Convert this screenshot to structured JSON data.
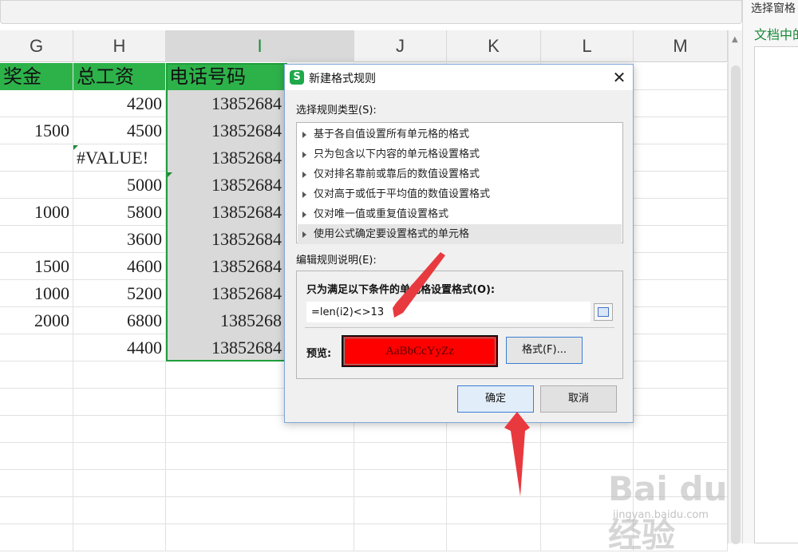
{
  "columns": [
    {
      "label": "G",
      "selected": false
    },
    {
      "label": "H",
      "selected": false
    },
    {
      "label": "I",
      "selected": true
    },
    {
      "label": "J",
      "selected": false
    },
    {
      "label": "K",
      "selected": false
    },
    {
      "label": "L",
      "selected": false
    },
    {
      "label": "M",
      "selected": false
    }
  ],
  "header_row": {
    "g": "奖金",
    "h": "总工资",
    "i": "电话号码"
  },
  "rows": [
    {
      "g": "",
      "h": "4200",
      "i": "13852684"
    },
    {
      "g": "1500",
      "h": "4500",
      "i": "13852684"
    },
    {
      "g": "",
      "h": "#VALUE!",
      "i": "13852684"
    },
    {
      "g": "",
      "h": "5000",
      "i": "13852684"
    },
    {
      "g": "1000",
      "h": "5800",
      "i": "13852684"
    },
    {
      "g": "",
      "h": "3600",
      "i": "13852684"
    },
    {
      "g": "1500",
      "h": "4600",
      "i": "13852684"
    },
    {
      "g": "1000",
      "h": "5200",
      "i": "13852684"
    },
    {
      "g": "2000",
      "h": "6800",
      "i": "1385268"
    },
    {
      "g": "",
      "h": "4400",
      "i": "13852684"
    }
  ],
  "pane": {
    "title": "选择窗格",
    "subtitle": "文档中的"
  },
  "dialog": {
    "logo": "S",
    "title": "新建格式规则",
    "close_glyph": "✕",
    "rule_type_label": "选择规则类型(S):",
    "rule_types": [
      "基于各自值设置所有单元格的格式",
      "只为包含以下内容的单元格设置格式",
      "仅对排名靠前或靠后的数值设置格式",
      "仅对高于或低于平均值的数值设置格式",
      "仅对唯一值或重复值设置格式",
      "使用公式确定要设置格式的单元格"
    ],
    "selected_rule_index": 5,
    "edit_desc_label": "编辑规则说明(E):",
    "condition_label": "只为满足以下条件的单元格设置格式(O):",
    "formula_value": "=len(i2)<>13",
    "picker_icon": "range-picker-icon",
    "preview_label": "预览:",
    "preview_text": "AaBbCcYyZz",
    "format_button": "格式(F)...",
    "ok_button": "确定",
    "cancel_button": "取消"
  },
  "watermark": {
    "main": "Bai du 经验",
    "sub": "jingyan.baidu.com"
  },
  "colors": {
    "header_green": "#2db24a",
    "selection_green": "#1e9e3b",
    "preview_red": "#ff0000",
    "annotation_red": "#e8393f",
    "accent_blue": "#3c7fd1"
  }
}
